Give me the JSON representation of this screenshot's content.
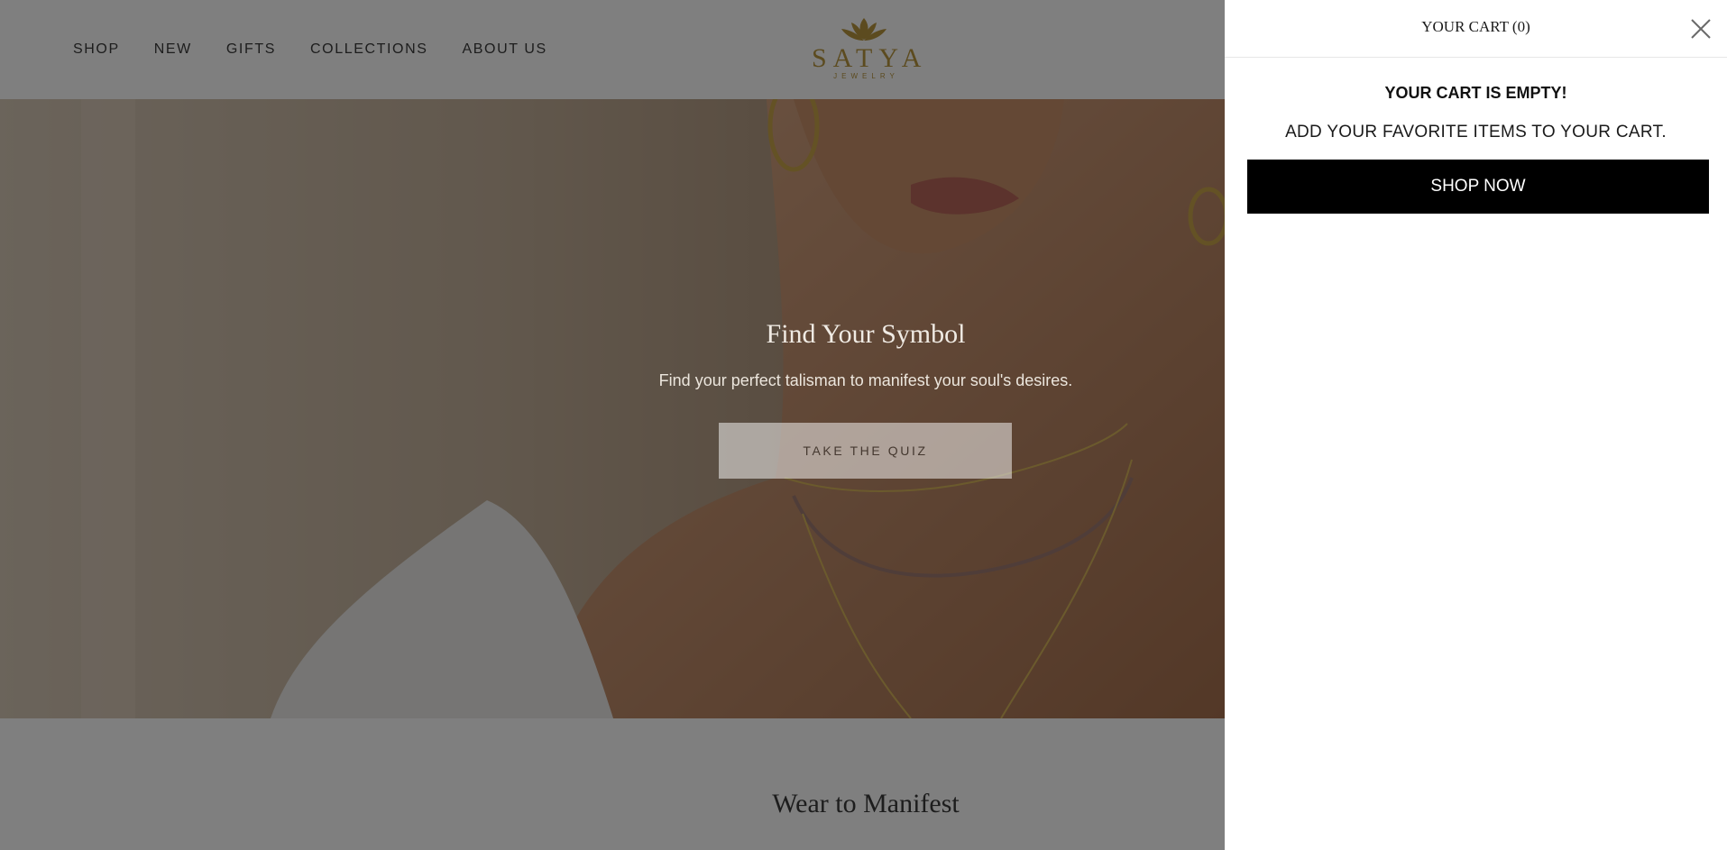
{
  "nav": {
    "items": [
      {
        "label": "SHOP"
      },
      {
        "label": "NEW"
      },
      {
        "label": "GIFTS"
      },
      {
        "label": "COLLECTIONS"
      },
      {
        "label": "ABOUT US"
      }
    ]
  },
  "logo": {
    "name": "SATYA",
    "sub": "JEWELRY",
    "color": "#b8963f"
  },
  "hero": {
    "title": "Find Your Symbol",
    "subtitle": "Find your perfect talisman to manifest your soul's desires.",
    "cta_label": "TAKE THE QUIZ"
  },
  "section": {
    "title": "Wear to Manifest"
  },
  "cart": {
    "title": "YOUR CART (0)",
    "empty_title": "YOUR CART IS EMPTY!",
    "empty_message": "ADD YOUR FAVORITE ITEMS TO YOUR CART.",
    "button_label": "SHOP NOW",
    "close_icon": "close-icon"
  },
  "colors": {
    "overlay": "rgba(0,0,0,0.5)",
    "cart_button": "#000000",
    "brand_gold": "#b8963f"
  }
}
